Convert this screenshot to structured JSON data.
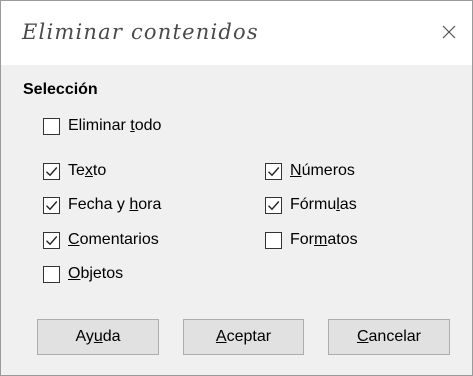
{
  "dialog": {
    "title": "Eliminar contenidos",
    "close_icon": "close-icon"
  },
  "selection": {
    "label": "Selección",
    "delete_all": {
      "label_pre": "Eliminar ",
      "label_mn": "t",
      "label_post": "odo",
      "checked": false
    },
    "left": [
      {
        "pre": "Te",
        "mn": "x",
        "post": "to",
        "checked": true
      },
      {
        "pre": "Fecha y ",
        "mn": "h",
        "post": "ora",
        "checked": true
      },
      {
        "pre": "",
        "mn": "C",
        "post": "omentarios",
        "checked": true
      },
      {
        "pre": "",
        "mn": "O",
        "post": "bjetos",
        "checked": false
      }
    ],
    "right": [
      {
        "pre": "",
        "mn": "N",
        "post": "úmeros",
        "checked": true
      },
      {
        "pre": "Fórmu",
        "mn": "l",
        "post": "as",
        "checked": true
      },
      {
        "pre": "For",
        "mn": "m",
        "post": "atos",
        "checked": false
      }
    ]
  },
  "buttons": {
    "help": {
      "pre": "Ay",
      "mn": "u",
      "post": "da"
    },
    "ok": {
      "pre": "",
      "mn": "A",
      "post": "ceptar"
    },
    "cancel": {
      "pre": "",
      "mn": "C",
      "post": "ancelar"
    }
  },
  "colors": {
    "dialog_bg": "#f0f0f0",
    "title_bg": "#ffffff",
    "title_text": "#4a4a4a",
    "button_bg": "#e1e1e1",
    "button_border": "#adadad",
    "checkbox_border": "#333333"
  }
}
